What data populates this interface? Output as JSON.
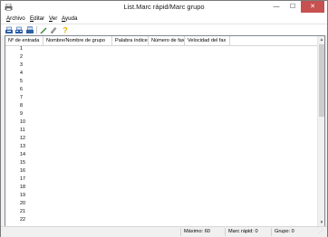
{
  "window": {
    "title": "List.Marc rápid/Marc grupo",
    "min_glyph": "—",
    "max_glyph": "☐",
    "close_glyph": "✕"
  },
  "menu": [
    {
      "label": "Archivo"
    },
    {
      "label": "Editar"
    },
    {
      "label": "Ver"
    },
    {
      "label": "Ayuda"
    }
  ],
  "toolbar": {
    "icons": [
      "phone-add-icon",
      "group-add-icon",
      "address-book-icon",
      "edit-icon",
      "delete-icon",
      "help-icon"
    ]
  },
  "list": {
    "columns": [
      "Nº de entrada",
      "Nombre/Nombre de grupo",
      "Palabra índice",
      "Número de fax",
      "Velocidad del fax"
    ],
    "rows": [
      "1",
      "2",
      "3",
      "4",
      "5",
      "6",
      "7",
      "8",
      "9",
      "10",
      "11",
      "12",
      "13",
      "14",
      "15",
      "16",
      "17",
      "18",
      "19",
      "20",
      "21",
      "22"
    ]
  },
  "status": {
    "maximo": "Máximo: 60",
    "marc_rapid": "Marc rápid: 0",
    "grupo": "Grupo: 0"
  }
}
